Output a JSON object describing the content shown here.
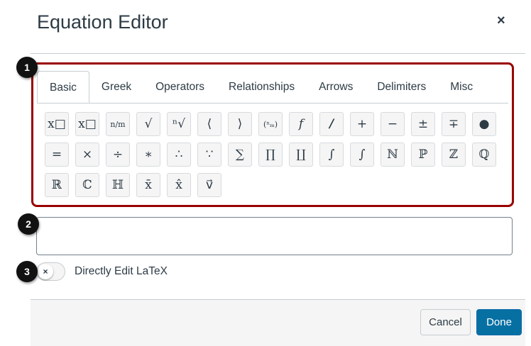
{
  "title": "Equation Editor",
  "close": "×",
  "tabs": [
    "Basic",
    "Greek",
    "Operators",
    "Relationships",
    "Arrows",
    "Delimiters",
    "Misc"
  ],
  "buttons": [
    {
      "name": "subscript",
      "glyph": "x□"
    },
    {
      "name": "superscript",
      "glyph": "x□"
    },
    {
      "name": "fraction",
      "glyph": "n/m"
    },
    {
      "name": "square-root",
      "glyph": "√"
    },
    {
      "name": "nth-root",
      "glyph": "ⁿ√"
    },
    {
      "name": "left-angle",
      "glyph": "⟨"
    },
    {
      "name": "right-angle",
      "glyph": "⟩"
    },
    {
      "name": "binomial",
      "glyph": "(ⁿₘ)"
    },
    {
      "name": "function",
      "glyph": "𝑓"
    },
    {
      "name": "bold-slash",
      "glyph": "/"
    },
    {
      "name": "plus",
      "glyph": "+"
    },
    {
      "name": "minus",
      "glyph": "−"
    },
    {
      "name": "plus-minus",
      "glyph": "±"
    },
    {
      "name": "minus-plus",
      "glyph": "∓"
    },
    {
      "name": "bullet",
      "glyph": "●"
    },
    {
      "name": "equals",
      "glyph": "="
    },
    {
      "name": "times",
      "glyph": "×"
    },
    {
      "name": "divide",
      "glyph": "÷"
    },
    {
      "name": "asterisk",
      "glyph": "∗"
    },
    {
      "name": "therefore",
      "glyph": "∴"
    },
    {
      "name": "because",
      "glyph": "∵"
    },
    {
      "name": "sum",
      "glyph": "∑"
    },
    {
      "name": "product",
      "glyph": "∏"
    },
    {
      "name": "coproduct",
      "glyph": "∐"
    },
    {
      "name": "definite-integral",
      "glyph": "∫"
    },
    {
      "name": "integral",
      "glyph": "∫"
    },
    {
      "name": "naturals",
      "glyph": "ℕ"
    },
    {
      "name": "primes",
      "glyph": "ℙ"
    },
    {
      "name": "integers",
      "glyph": "ℤ"
    },
    {
      "name": "rationals",
      "glyph": "ℚ"
    },
    {
      "name": "reals",
      "glyph": "ℝ"
    },
    {
      "name": "complex",
      "glyph": "ℂ"
    },
    {
      "name": "quaternions",
      "glyph": "ℍ"
    },
    {
      "name": "overline",
      "glyph": "x̄"
    },
    {
      "name": "hat",
      "glyph": "x̂"
    },
    {
      "name": "vector",
      "glyph": "v⃗"
    }
  ],
  "toggle_label": "Directly Edit LaTeX",
  "toggle_state": "off",
  "toggle_icon": "×",
  "cancel": "Cancel",
  "done": "Done",
  "callouts": [
    "1",
    "2",
    "3"
  ],
  "colors": {
    "highlight": "#990000",
    "primary": "#0770a3"
  }
}
